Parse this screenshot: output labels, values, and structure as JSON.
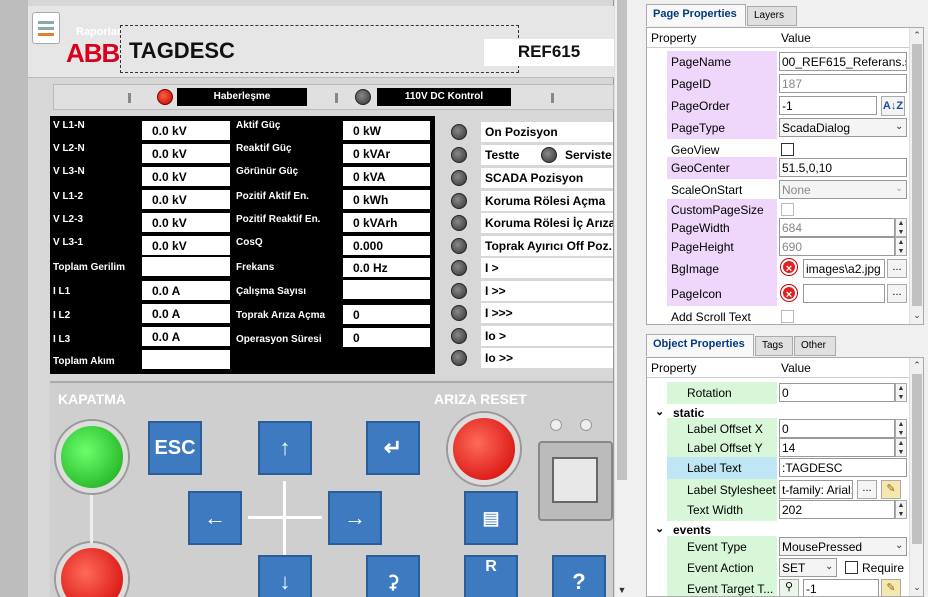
{
  "relay": {
    "app_label": "Raporlar",
    "brand": "ABB",
    "tag_desc": "TAGDESC",
    "model": "REF615",
    "leds": [
      {
        "label": "Haberleşme"
      },
      {
        "label": "110V DC Kontrol"
      }
    ],
    "measurements_left": [
      {
        "label": "V L1-N",
        "value": "0.0 kV"
      },
      {
        "label": "V L2-N",
        "value": "0.0 kV"
      },
      {
        "label": "V L3-N",
        "value": "0.0 kV"
      },
      {
        "label": "V L1-2",
        "value": "0.0 kV"
      },
      {
        "label": "V L2-3",
        "value": "0.0 kV"
      },
      {
        "label": "V L3-1",
        "value": "0.0 kV"
      },
      {
        "label": "Toplam Gerilim",
        "value": ""
      },
      {
        "label": "I L1",
        "value": "0.0 A"
      },
      {
        "label": "I L2",
        "value": "0.0 A"
      },
      {
        "label": "I L3",
        "value": "0.0 A"
      },
      {
        "label": "Toplam Akım",
        "value": ""
      }
    ],
    "measurements_right": [
      {
        "label": "Aktif Güç",
        "value": "0 kW"
      },
      {
        "label": "Reaktif Güç",
        "value": "0 kVAr"
      },
      {
        "label": "Görünür Güç",
        "value": "0 kVA"
      },
      {
        "label": "Pozitif Aktif En.",
        "value": "0 kWh"
      },
      {
        "label": "Pozitif Reaktif En.",
        "value": "0 kVArh"
      },
      {
        "label": "CosQ",
        "value": "0.000"
      },
      {
        "label": "Frekans",
        "value": "0.0 Hz"
      },
      {
        "label": "Çalışma Sayısı",
        "value": ""
      },
      {
        "label": "Toprak Arıza Açma",
        "value": "0"
      },
      {
        "label": "Operasyon Süresi",
        "value": "0"
      }
    ],
    "status": [
      "On Pozisyon",
      "Testte",
      "SCADA Pozisyon",
      "Koruma Rölesi Açma",
      "Koruma Rölesi İç Arıza",
      "Toprak Ayırıcı Off Poz.",
      "I >",
      "I >>",
      "I >>>",
      "Io >",
      "Io >>"
    ],
    "status_extra": "Serviste",
    "panel": {
      "close_label": "KAPATMA",
      "reset_label": "ARIZA RESET",
      "esc": "ESC",
      "r_label": "R",
      "help": "?"
    }
  },
  "page_properties": {
    "tabs": [
      "Page Properties",
      "Layers"
    ],
    "header": {
      "property": "Property",
      "value": "Value"
    },
    "rows": [
      {
        "name": "PageName",
        "value": "00_REF615_Referans.sca"
      },
      {
        "name": "PageID",
        "value": "187"
      },
      {
        "name": "PageOrder",
        "value": "-1"
      },
      {
        "name": "PageType",
        "value": "ScadaDialog"
      },
      {
        "name": "GeoView",
        "value": ""
      },
      {
        "name": "GeoCenter",
        "value": "51.5,0,10"
      },
      {
        "name": "ScaleOnStart",
        "value": "None"
      },
      {
        "name": "CustomPageSize",
        "value": ""
      },
      {
        "name": "PageWidth",
        "value": "684"
      },
      {
        "name": "PageHeight",
        "value": "690"
      },
      {
        "name": "BgImage",
        "value": "images\\a2.jpg"
      },
      {
        "name": "PageIcon",
        "value": ""
      },
      {
        "name": "Add Scroll Text",
        "value": ""
      }
    ],
    "sort_icon": "A↓Z"
  },
  "object_properties": {
    "tabs": [
      "Object Properties",
      "Tags",
      "Other"
    ],
    "header": {
      "property": "Property",
      "value": "Value"
    },
    "rows_before": [
      {
        "name": "Rotation",
        "value": "0"
      }
    ],
    "sec_static": "static",
    "static_rows": [
      {
        "name": "Label Offset X",
        "value": "0"
      },
      {
        "name": "Label Offset Y",
        "value": "14"
      },
      {
        "name": "Label Text",
        "value": ":TAGDESC"
      },
      {
        "name": "Label Stylesheet",
        "value": "t-family: Arial;"
      },
      {
        "name": "Text Width",
        "value": "202"
      }
    ],
    "sec_events": "events",
    "event_rows": [
      {
        "name": "Event Type",
        "value": "MousePressed"
      },
      {
        "name": "Event Action",
        "value": "SET",
        "extra": "Require"
      },
      {
        "name": "Event Target T...",
        "value": "-1"
      }
    ]
  },
  "colors": {
    "accent_pink": "#efd6fb",
    "accent_green": "#d8f6d8",
    "abb_red": "#d8001d",
    "key_blue": "#3d7ac0"
  }
}
